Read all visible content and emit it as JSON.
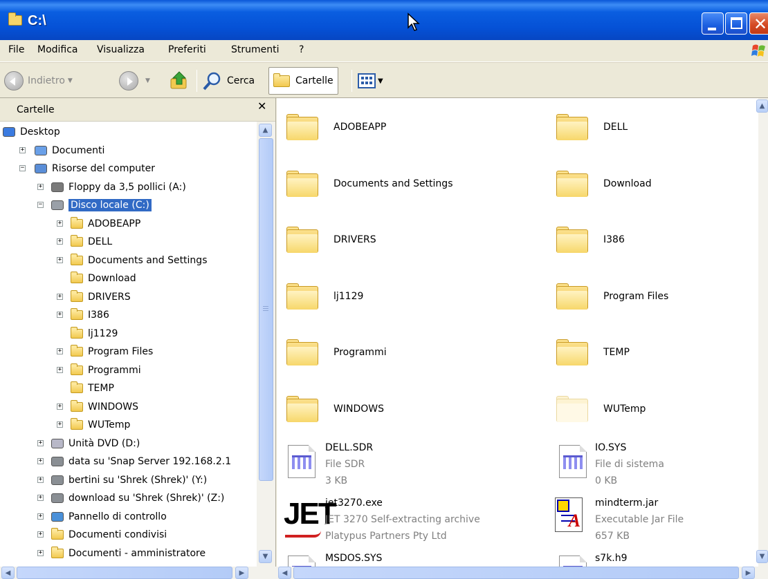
{
  "window": {
    "title": "C:\\"
  },
  "menu": {
    "items": [
      "File",
      "Modifica",
      "Visualizza",
      "Preferiti",
      "Strumenti",
      "?"
    ]
  },
  "toolbar": {
    "back_label": "Indietro",
    "search_label": "Cerca",
    "folders_label": "Cartelle"
  },
  "left_panel": {
    "header": "Cartelle",
    "tree": [
      {
        "label": "Desktop",
        "icon": "desktop-icon",
        "level": 0,
        "expander": ""
      },
      {
        "label": "Documenti",
        "icon": "documents-icon",
        "level": 1,
        "expander": "+"
      },
      {
        "label": "Risorse del computer",
        "icon": "computer-icon",
        "level": 1,
        "expander": "-"
      },
      {
        "label": "Floppy da 3,5 pollici (A:)",
        "icon": "floppy-icon",
        "level": 2,
        "expander": "+"
      },
      {
        "label": "Disco locale (C:)",
        "icon": "harddisk-icon",
        "level": 2,
        "expander": "-",
        "selected": true
      },
      {
        "label": "ADOBEAPP",
        "icon": "folder-icon",
        "level": 3,
        "expander": "+"
      },
      {
        "label": "DELL",
        "icon": "folder-icon",
        "level": 3,
        "expander": "+"
      },
      {
        "label": "Documents and Settings",
        "icon": "folder-icon",
        "level": 3,
        "expander": "+"
      },
      {
        "label": "Download",
        "icon": "folder-icon",
        "level": 3,
        "expander": ""
      },
      {
        "label": "DRIVERS",
        "icon": "folder-icon",
        "level": 3,
        "expander": "+"
      },
      {
        "label": "I386",
        "icon": "folder-icon",
        "level": 3,
        "expander": "+"
      },
      {
        "label": "lj1129",
        "icon": "folder-icon",
        "level": 3,
        "expander": ""
      },
      {
        "label": "Program Files",
        "icon": "folder-icon",
        "level": 3,
        "expander": "+"
      },
      {
        "label": "Programmi",
        "icon": "folder-icon",
        "level": 3,
        "expander": "+"
      },
      {
        "label": "TEMP",
        "icon": "folder-icon",
        "level": 3,
        "expander": ""
      },
      {
        "label": "WINDOWS",
        "icon": "folder-icon",
        "level": 3,
        "expander": "+"
      },
      {
        "label": "WUTemp",
        "icon": "folder-icon",
        "level": 3,
        "expander": "+"
      },
      {
        "label": "Unità DVD (D:)",
        "icon": "dvd-icon",
        "level": 2,
        "expander": "+"
      },
      {
        "label": "data su 'Snap Server 192.168.2.1",
        "icon": "network-drive-icon",
        "level": 2,
        "expander": "+"
      },
      {
        "label": "bertini su 'Shrek (Shrek)' (Y:)",
        "icon": "network-drive-icon",
        "level": 2,
        "expander": "+"
      },
      {
        "label": "download su 'Shrek (Shrek)' (Z:)",
        "icon": "network-drive-icon",
        "level": 2,
        "expander": "+"
      },
      {
        "label": "Pannello di controllo",
        "icon": "control-panel-icon",
        "level": 2,
        "expander": "+"
      },
      {
        "label": "Documenti condivisi",
        "icon": "folder-icon",
        "level": 2,
        "expander": "+"
      },
      {
        "label": "Documenti - amministratore",
        "icon": "folder-icon",
        "level": 2,
        "expander": "+"
      }
    ]
  },
  "content": {
    "folders": [
      {
        "name": "ADOBEAPP"
      },
      {
        "name": "DELL"
      },
      {
        "name": "Documents and Settings"
      },
      {
        "name": "Download"
      },
      {
        "name": "DRIVERS"
      },
      {
        "name": "I386"
      },
      {
        "name": "lj1129"
      },
      {
        "name": "Program Files"
      },
      {
        "name": "Programmi"
      },
      {
        "name": "TEMP"
      },
      {
        "name": "WINDOWS"
      },
      {
        "name": "WUTemp",
        "hidden": true
      }
    ],
    "files": [
      {
        "name": "DELL.SDR",
        "type": "File SDR",
        "detail": "3 KB",
        "icon": "system-file-icon"
      },
      {
        "name": "IO.SYS",
        "type": "File di sistema",
        "detail": "0 KB",
        "icon": "system-file-icon"
      },
      {
        "name": "jet3270.exe",
        "type": "JET 3270 Self-extracting archive",
        "detail": "Platypus Partners Pty Ltd",
        "icon": "jet-logo-icon"
      },
      {
        "name": "mindterm.jar",
        "type": "Executable Jar File",
        "detail": "657 KB",
        "icon": "jar-file-icon"
      },
      {
        "name": "MSDOS.SYS",
        "icon": "system-file-icon"
      },
      {
        "name": "s7k.h9",
        "icon": "system-file-icon"
      }
    ]
  },
  "colors": {
    "titlebar": "#0a5ee0",
    "selection": "#316ac5",
    "chrome": "#ece9d8"
  }
}
